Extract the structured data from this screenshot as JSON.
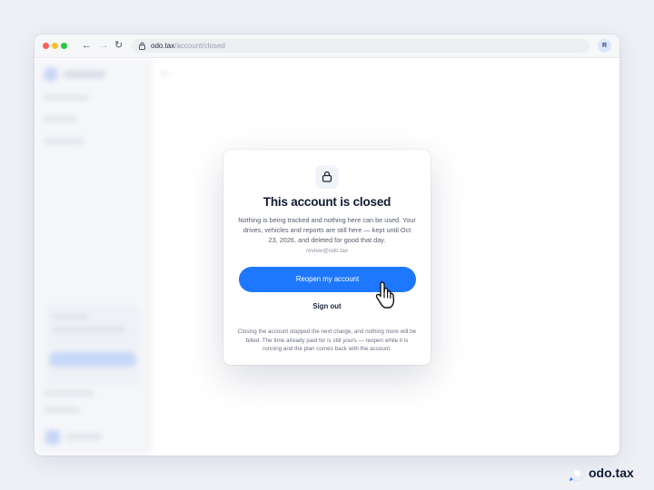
{
  "browser": {
    "url_host": "odo.tax",
    "url_path": "/account/closed",
    "profile_initial": "R",
    "icons": [
      "back-arrow-icon",
      "forward-arrow-icon",
      "reload-icon",
      "lock-icon"
    ]
  },
  "modal": {
    "icon": "lock-icon",
    "title": "This account is closed",
    "body": "Nothing is being tracked and nothing here can be used. Your drives, vehicles and reports are still here — kept until Oct 23, 2026, and deleted for good that day.",
    "email": "review@odo.tax",
    "primary_button": "Reopen my account",
    "secondary_button": "Sign out",
    "footnote": "Closing the account stopped the next charge, and nothing more will be billed. The time already paid for is still yours — reopen while it is running and the plan comes back with the account."
  },
  "brand": {
    "name": "odo.tax",
    "accent": "#1e78ff"
  },
  "colors": {
    "primary": "#1e78ff",
    "title": "#0f1b33",
    "background": "#eef0f6"
  }
}
